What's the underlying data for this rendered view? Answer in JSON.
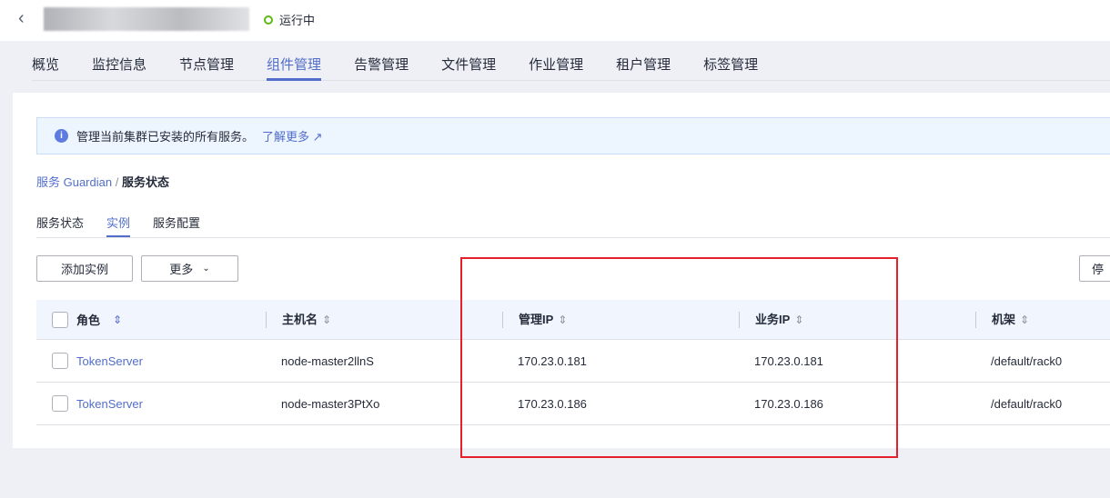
{
  "header": {
    "status": "运行中",
    "status_color": "#5fb814"
  },
  "tabs": [
    "概览",
    "监控信息",
    "节点管理",
    "组件管理",
    "告警管理",
    "文件管理",
    "作业管理",
    "租户管理",
    "标签管理"
  ],
  "active_tab": "组件管理",
  "info": {
    "text": "管理当前集群已安装的所有服务。",
    "link": "了解更多"
  },
  "breadcrumb": {
    "parent": "服务 Guardian",
    "sep": "/",
    "current": "服务状态"
  },
  "subtabs": [
    "服务状态",
    "实例",
    "服务配置"
  ],
  "toolbar": {
    "add": "添加实例",
    "more": "更多",
    "stop": "停"
  },
  "table": {
    "columns": [
      "角色",
      "主机名",
      "管理IP",
      "业务IP",
      "机架"
    ],
    "rows": [
      [
        "TokenServer",
        "node-master2llnS",
        "170.23.0.181",
        "170.23.0.181",
        "/default/rack0"
      ],
      [
        "TokenServer",
        "node-master3PtXo",
        "170.23.0.186",
        "170.23.0.186",
        "/default/rack0"
      ]
    ]
  },
  "accent": "#526ecc"
}
